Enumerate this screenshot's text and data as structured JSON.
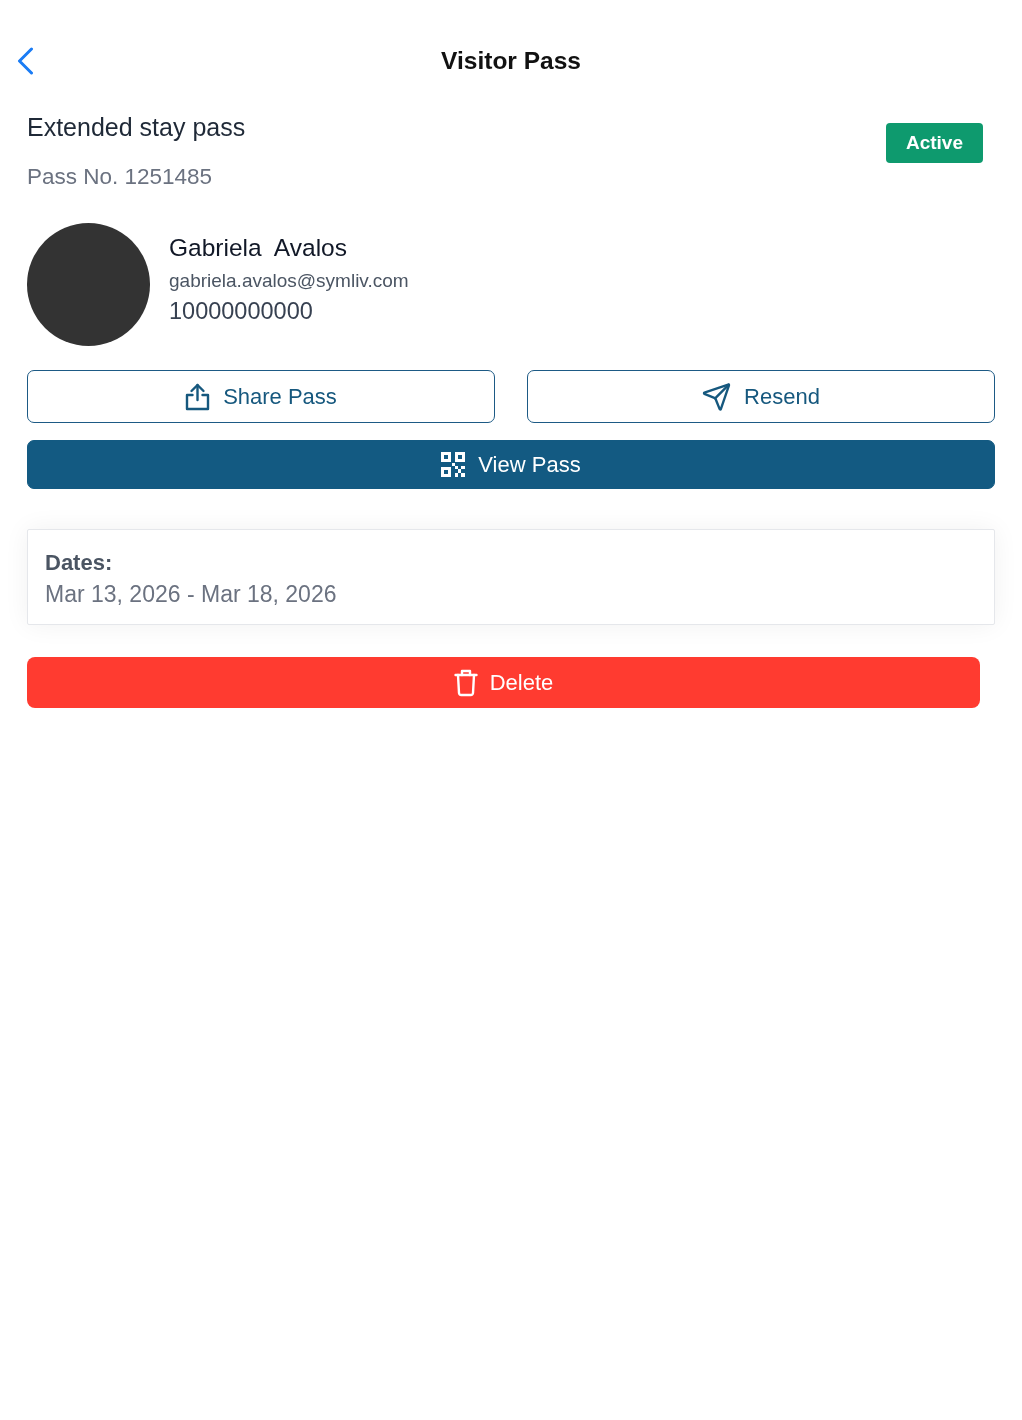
{
  "header": {
    "title": "Visitor Pass"
  },
  "pass": {
    "type": "Extended stay pass",
    "number": "Pass No. 1251485",
    "status": {
      "label": "Active",
      "kind": "active"
    }
  },
  "visitor": {
    "name": "Gabriela  Avalos",
    "email": "gabriela.avalos@symliv.com",
    "phone": "10000000000"
  },
  "actions": [
    {
      "kind": "share",
      "label": "Share Pass"
    },
    {
      "kind": "resend",
      "label": "Resend"
    },
    {
      "kind": "view",
      "label": "View Pass"
    }
  ],
  "dates": {
    "label": "Dates:",
    "value": "Mar 13, 2026 - Mar 18, 2026"
  },
  "delete_action": {
    "label": "Delete"
  }
}
